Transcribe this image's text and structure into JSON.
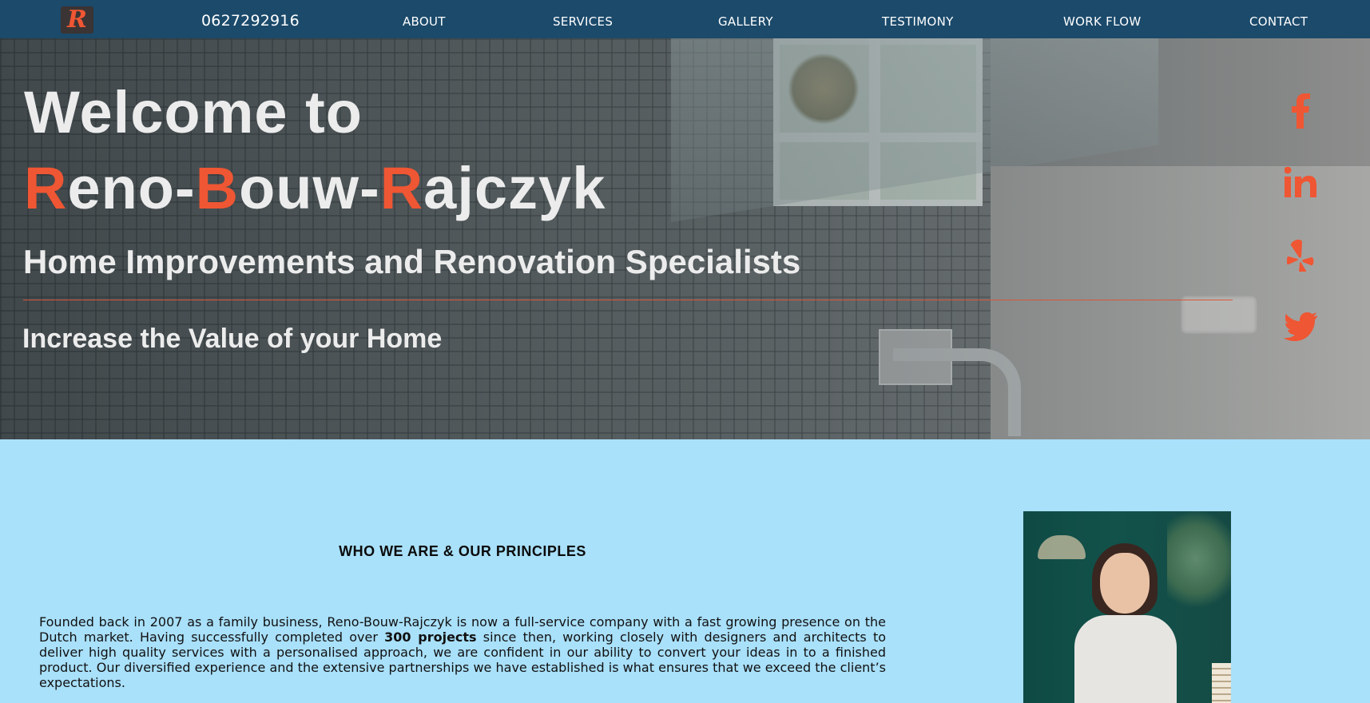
{
  "nav": {
    "logo_letter": "R",
    "phone": "0627292916",
    "links": [
      "ABOUT",
      "SERVICES",
      "GALLERY",
      "TESTIMONY",
      "WORK FLOW",
      "CONTACT"
    ]
  },
  "hero": {
    "welcome": "Welcome to",
    "brand_parts": [
      {
        "accent": "R",
        "rest": "eno-"
      },
      {
        "accent": "B",
        "rest": "ouw-"
      },
      {
        "accent": "R",
        "rest": "ajczyk"
      }
    ],
    "subtitle": "Home Improvements and Renovation Specialists",
    "tagline": "Increase the Value of your Home"
  },
  "social": [
    {
      "name": "facebook-icon"
    },
    {
      "name": "linkedin-icon"
    },
    {
      "name": "yelp-icon"
    },
    {
      "name": "twitter-icon"
    }
  ],
  "about": {
    "title": "WHO WE ARE & OUR PRINCIPLES",
    "text_before": "Founded back in 2007 as a family business, Reno-Bouw-Rajczyk is now a full-service company with a fast growing presence on the Dutch market. Having successfully completed over ",
    "text_bold": "300 projects",
    "text_after": " since then, working closely with designers and architects to deliver high quality services with a personalised approach, we are confident in our ability to convert your ideas in to a finished product. Our diversified experience and the extensive partnerships we have established is what ensures that we exceed the client’s expectations."
  },
  "colors": {
    "nav_bg": "#1b4a6b",
    "accent": "#ef5633",
    "section_bg": "#a9e0fa"
  }
}
